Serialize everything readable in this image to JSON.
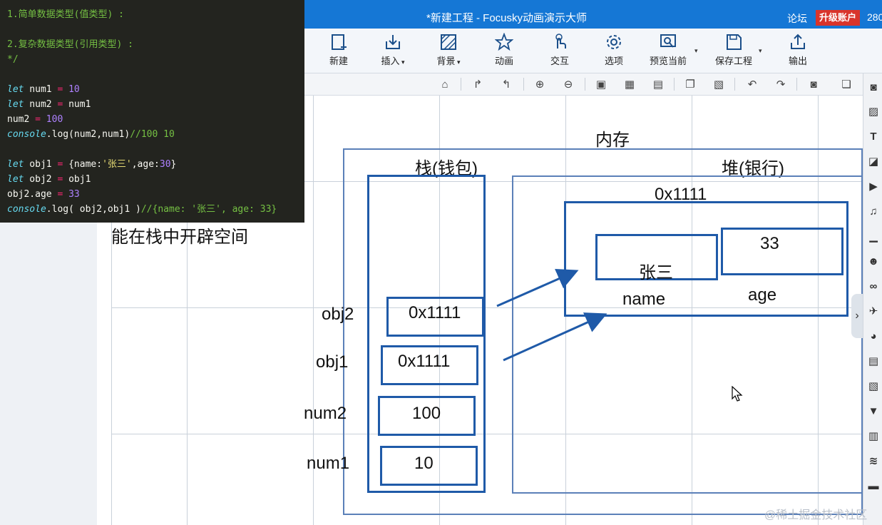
{
  "window": {
    "title": "*新建工程 - Focusky动画演示大师",
    "forum": "论坛",
    "upgrade": "升级账户",
    "number_fragment": "280"
  },
  "ribbon": [
    {
      "label": "新建",
      "icon": "new-page-icon",
      "dropdown": false
    },
    {
      "label": "插入",
      "icon": "insert-icon",
      "dropdown": true
    },
    {
      "label": "背景",
      "icon": "background-icon",
      "dropdown": true
    },
    {
      "label": "动画",
      "icon": "star-animation-icon",
      "dropdown": false
    },
    {
      "label": "交互",
      "icon": "hand-pointer-icon",
      "dropdown": false
    },
    {
      "label": "选项",
      "icon": "gear-icon",
      "dropdown": false
    },
    {
      "label": "预览当前",
      "icon": "preview-icon",
      "dropdown": true
    },
    {
      "label": "保存工程",
      "icon": "save-icon",
      "dropdown": true
    },
    {
      "label": "输出",
      "icon": "export-icon",
      "dropdown": false
    }
  ],
  "code": {
    "lines": [
      [
        {
          "t": "1.简单数据类型(值类型) :",
          "c": "cm"
        }
      ],
      [],
      [
        {
          "t": "2.复杂数据类型(引用类型) :",
          "c": "cm"
        }
      ],
      [
        {
          "t": "*/",
          "c": "cm"
        }
      ],
      [],
      [
        {
          "t": "let",
          "c": "kw"
        },
        {
          "t": " num1 "
        },
        {
          "t": "=",
          "c": "op"
        },
        {
          "t": " "
        },
        {
          "t": "10",
          "c": "nm"
        }
      ],
      [
        {
          "t": "let",
          "c": "kw"
        },
        {
          "t": " num2 "
        },
        {
          "t": "=",
          "c": "op"
        },
        {
          "t": " num1"
        }
      ],
      [
        {
          "t": "num2 "
        },
        {
          "t": "=",
          "c": "op"
        },
        {
          "t": " "
        },
        {
          "t": "100",
          "c": "nm"
        }
      ],
      [
        {
          "t": "console",
          "c": "kw"
        },
        {
          "t": ".log(num2,num1)"
        },
        {
          "t": "//100 10",
          "c": "cm"
        }
      ],
      [],
      [
        {
          "t": "let",
          "c": "kw"
        },
        {
          "t": " obj1 "
        },
        {
          "t": "=",
          "c": "op"
        },
        {
          "t": " {name:"
        },
        {
          "t": "'张三'",
          "c": "str"
        },
        {
          "t": ",age:"
        },
        {
          "t": "30",
          "c": "nm"
        },
        {
          "t": "}"
        }
      ],
      [
        {
          "t": "let",
          "c": "kw"
        },
        {
          "t": " obj2 "
        },
        {
          "t": "=",
          "c": "op"
        },
        {
          "t": " obj1"
        }
      ],
      [
        {
          "t": "obj2.age "
        },
        {
          "t": "=",
          "c": "op"
        },
        {
          "t": " "
        },
        {
          "t": "33",
          "c": "nm"
        }
      ],
      [
        {
          "t": "console",
          "c": "kw"
        },
        {
          "t": ".log( obj2,obj1 )"
        },
        {
          "t": "//{name: '张三', age: 33}",
          "c": "cm"
        }
      ]
    ]
  },
  "diagram": {
    "memory_title": "内存",
    "stack_title": "栈(钱包)",
    "heap_title": "堆(银行)",
    "note": "能在栈中开辟空间",
    "heap_address": "0x1111",
    "stack_rows": [
      {
        "name": "obj2",
        "value": "0x1111"
      },
      {
        "name": "obj1",
        "value": "0x1111"
      },
      {
        "name": "num2",
        "value": "100"
      },
      {
        "name": "num1",
        "value": "10"
      }
    ],
    "heap_fields": [
      {
        "key": "name",
        "value": "张三"
      },
      {
        "key": "age",
        "value": "33"
      }
    ]
  },
  "watermark": "@稀土掘金技术社区",
  "colors": {
    "titlebar": "#1577d5",
    "upgrade": "#d9342b",
    "diagram_line": "#1f5aa8"
  }
}
